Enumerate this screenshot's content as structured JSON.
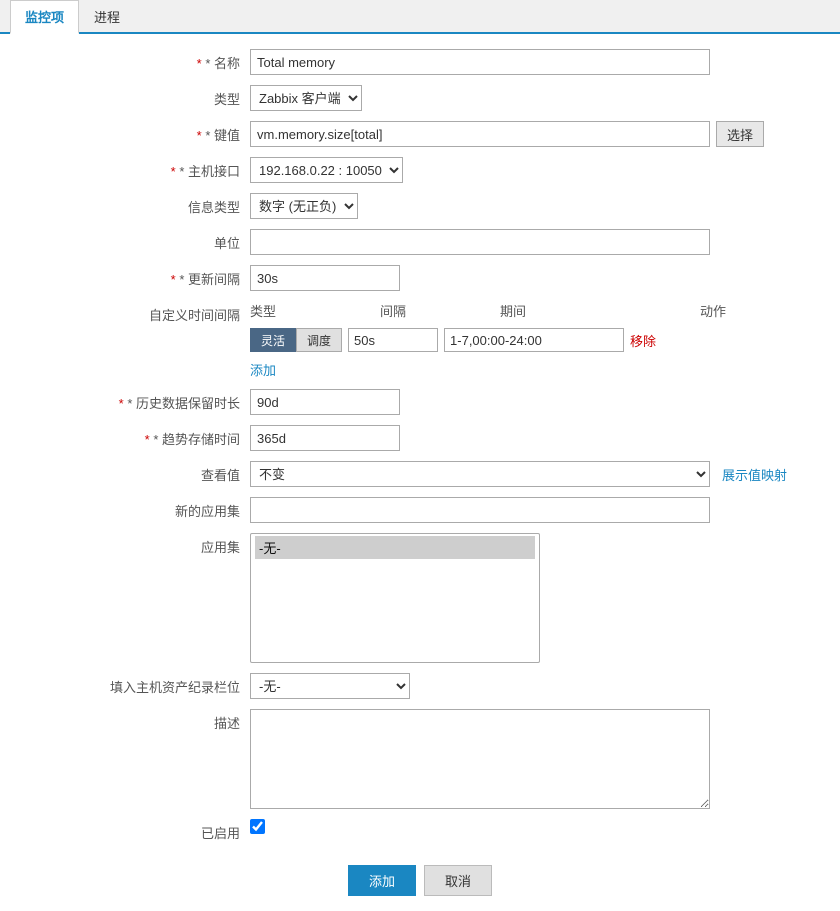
{
  "tabs": [
    {
      "id": "monitor",
      "label": "监控项",
      "active": true
    },
    {
      "id": "process",
      "label": "进程",
      "active": false
    }
  ],
  "form": {
    "name_label": "* 名称",
    "name_value": "Total memory",
    "type_label": "类型",
    "type_value": "Zabbix 客户端",
    "key_label": "* 键值",
    "key_value": "vm.memory.size[total]",
    "key_select_btn": "选择",
    "host_interface_label": "* 主机接口",
    "host_interface_value": "192.168.0.22 : 10050",
    "info_type_label": "信息类型",
    "info_type_value": "数字 (无正负)",
    "unit_label": "单位",
    "unit_value": "",
    "update_interval_label": "* 更新间隔",
    "update_interval_value": "30s",
    "custom_interval_label": "自定义时间间隔",
    "custom_interval_headers": {
      "type": "类型",
      "interval": "间隔",
      "period": "期间",
      "action": "动作"
    },
    "custom_interval_row": {
      "type_flexible": "灵活",
      "type_scheduled": "调度",
      "interval_value": "50s",
      "period_value": "1-7,00:00-24:00",
      "remove_label": "移除"
    },
    "add_link": "添加",
    "history_label": "* 历史数据保留时长",
    "history_value": "90d",
    "trend_label": "* 趋势存储时间",
    "trend_value": "365d",
    "check_value_label": "查看值",
    "check_value_option": "不变",
    "show_mapping_label": "展示值映射",
    "new_app_label": "新的应用集",
    "new_app_value": "",
    "app_set_label": "应用集",
    "app_set_option": "-无-",
    "host_asset_label": "填入主机资产纪录栏位",
    "host_asset_option": "-无-",
    "desc_label": "描述",
    "desc_value": "",
    "enabled_label": "已启用",
    "enabled_checked": true,
    "add_button": "添加",
    "cancel_button": "取消"
  }
}
